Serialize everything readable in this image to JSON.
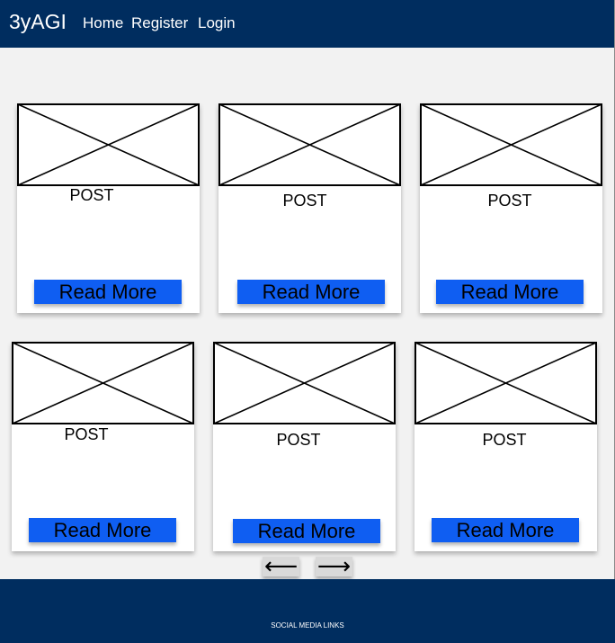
{
  "header": {
    "brand": "3yAGI",
    "nav": [
      "Home",
      "Register",
      "Login"
    ]
  },
  "posts": [
    {
      "title": "POST",
      "button": "Read More"
    },
    {
      "title": "POST",
      "button": "Read More"
    },
    {
      "title": "POST",
      "button": "Read More"
    },
    {
      "title": "POST",
      "button": "Read More"
    },
    {
      "title": "POST",
      "button": "Read More"
    },
    {
      "title": "POST",
      "button": "Read More"
    }
  ],
  "pagination": {
    "prev": "⟵",
    "next": "⟶"
  },
  "footer": {
    "text": "SOCIAL MEDIA LINKS"
  },
  "icons": {
    "image_placeholder": "image-placeholder-icon",
    "prev": "arrow-left-icon",
    "next": "arrow-right-icon"
  },
  "colors": {
    "header_bg": "#002d5f",
    "footer_bg": "#002d5f",
    "page_bg": "#f2f2f2",
    "card_bg": "#ffffff",
    "button_bg": "#0f5ef2",
    "arrow_bg": "#d9d9d9"
  }
}
